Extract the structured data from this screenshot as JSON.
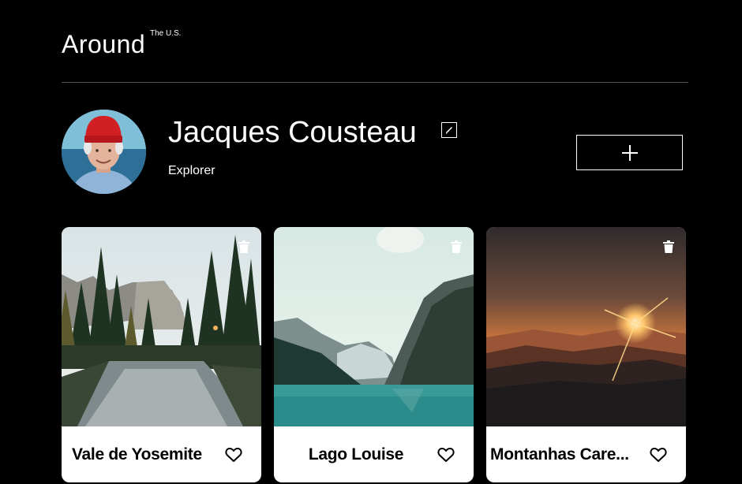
{
  "header": {
    "logo": "Around",
    "logo_superscript": "The U.S."
  },
  "profile": {
    "name": "Jacques Cousteau",
    "about": "Explorer",
    "avatar_alt": "avatar",
    "edit_icon": "pencil-icon",
    "add_icon": "plus-icon"
  },
  "cards": [
    {
      "title": "Vale de Yosemite",
      "liked": false
    },
    {
      "title": "Lago Louise",
      "liked": false
    },
    {
      "title": "Montanhas Care...",
      "liked": false
    }
  ],
  "colors": {
    "background": "#000000",
    "card": "#ffffff",
    "text": "#ffffff",
    "card_text": "#000000",
    "divider": "#545454"
  }
}
